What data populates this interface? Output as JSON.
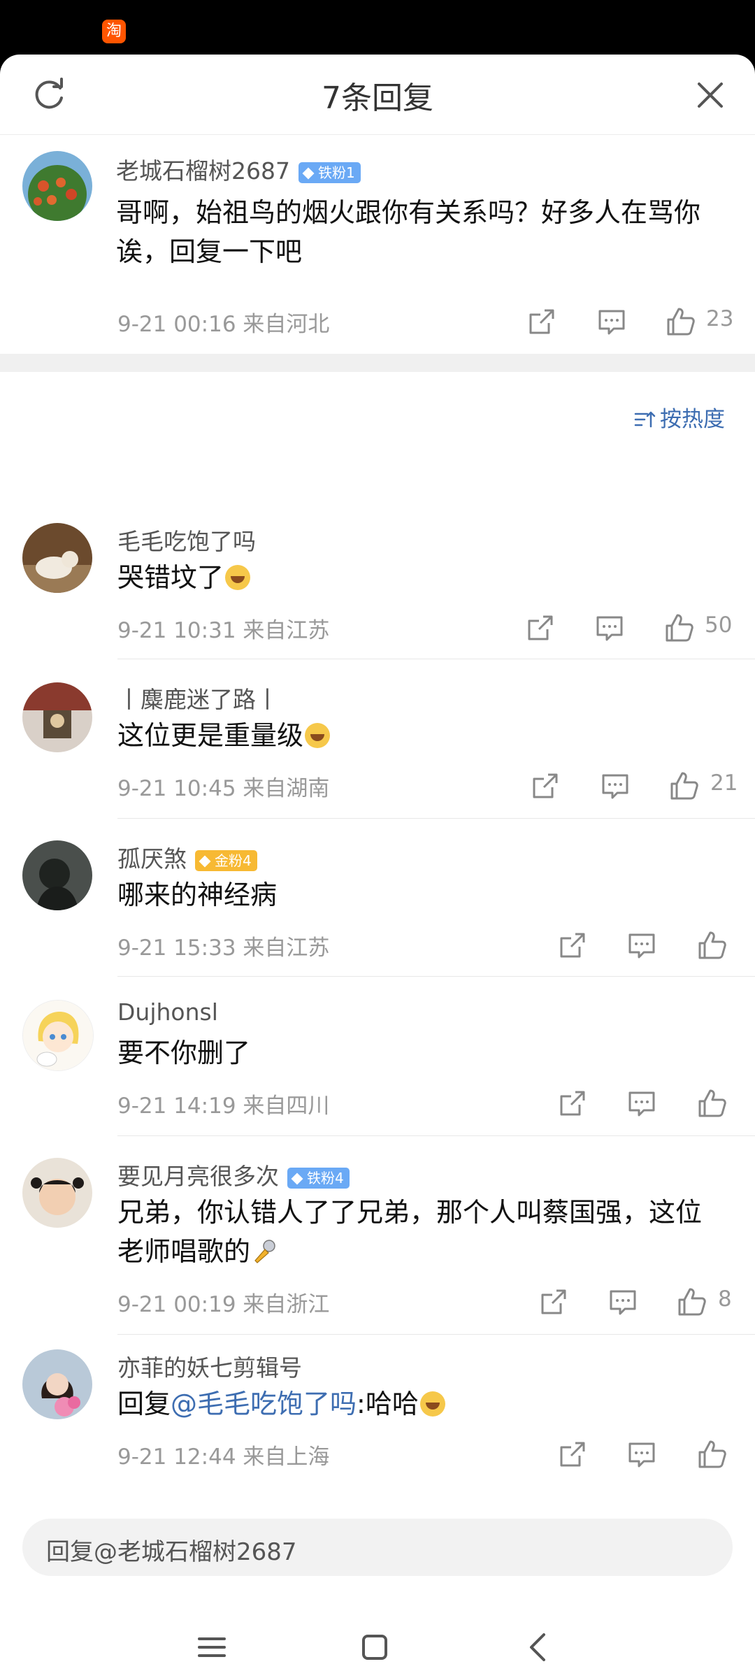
{
  "status_bar": {
    "app_icon": "taobao-icon",
    "app_glyph": "淘"
  },
  "header": {
    "title": "7条回复",
    "refresh_icon": "refresh-icon",
    "close_icon": "close-icon"
  },
  "root_comment": {
    "username": "老城石榴树2687",
    "badge": "铁粉1",
    "text": "哥啊，始祖鸟的烟火跟你有关系吗？好多人在骂你诶，回复一下吧",
    "meta": "9-21 00:16 来自河北",
    "likes": "23"
  },
  "sort_label": "按热度",
  "replies": [
    {
      "username": "毛毛吃饱了吗",
      "badge": "",
      "text": "哭错坟了",
      "meta": "9-21 10:31 来自江苏",
      "likes": "50"
    },
    {
      "username": "丨麋鹿迷了路丨",
      "badge": "",
      "text": "这位更是重量级",
      "meta": "9-21 10:45 来自湖南",
      "likes": "21"
    },
    {
      "username": "孤厌煞",
      "badge": "金粉4",
      "text": "哪来的神经病",
      "meta": "9-21 15:33 来自江苏",
      "likes": ""
    },
    {
      "username": "Dujhonsl",
      "badge": "",
      "text": "要不你删了",
      "meta": "9-21 14:19 来自四川",
      "likes": ""
    },
    {
      "username": "要见月亮很多次",
      "badge": "铁粉4",
      "text": "兄弟，你认错人了了兄弟，那个人叫蔡国强，这位老师唱歌的",
      "meta": "9-21 00:19 来自浙江",
      "likes": "8"
    },
    {
      "username": "亦菲的妖七剪辑号",
      "badge": "",
      "text_prefix": "回复",
      "mention": "@毛毛吃饱了吗",
      "text_suffix": ":哈哈",
      "meta": "9-21 12:44 来自上海",
      "likes": ""
    }
  ],
  "input": {
    "placeholder": "回复@老城石榴树2687"
  },
  "nav": {
    "menu_icon": "menu-icon",
    "home_icon": "home-icon",
    "back_icon": "back-icon"
  }
}
